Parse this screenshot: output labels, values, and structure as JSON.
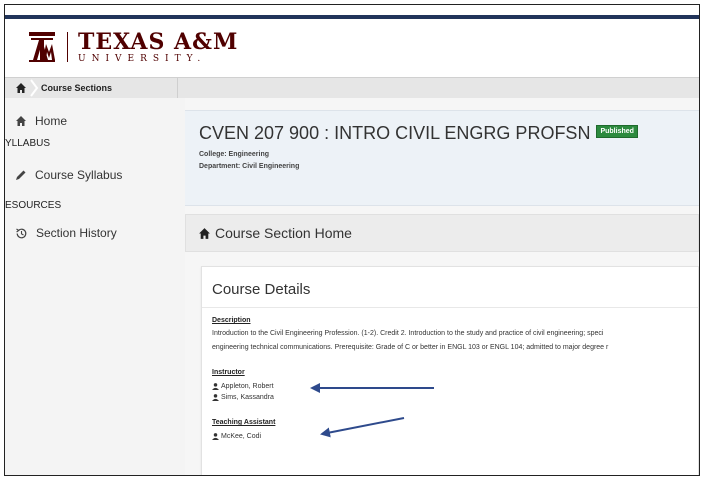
{
  "brand": {
    "name_top": "TEXAS A&M",
    "name_bottom": "UNIVERSITY."
  },
  "breadcrumb": {
    "current": "Course Sections"
  },
  "sidebar": {
    "home": "Home",
    "syllabus_heading": "YLLABUS",
    "course_syllabus": "Course Syllabus",
    "resources_heading": "ESOURCES",
    "section_history": "Section History"
  },
  "course": {
    "title": "CVEN 207 900 : INTRO CIVIL ENGRG PROFSN",
    "status_badge": "Published",
    "college": "College: Engineering",
    "department": "Department: Civil Engineering"
  },
  "section": {
    "title": "Course Section Home"
  },
  "details": {
    "title": "Course Details",
    "description_label": "Description",
    "description_line1": "Introduction to the Civil Engineering Profession. (1-2). Credit 2. Introduction to the study and practice of civil engineering; speci",
    "description_line2": "engineering technical communications. Prerequisite: Grade of C or better in ENGL 103 or ENGL 104; admitted to major degree r",
    "instructor_label": "Instructor",
    "instructors": [
      "Appleton, Robert",
      "Sims, Kassandra"
    ],
    "ta_label": "Teaching Assistant",
    "tas": [
      "McKee, Codi"
    ]
  },
  "colors": {
    "maroon": "#500000",
    "navy_bar": "#21345a",
    "badge_green": "#2c8a3e",
    "arrow_blue": "#2e4a8c"
  }
}
